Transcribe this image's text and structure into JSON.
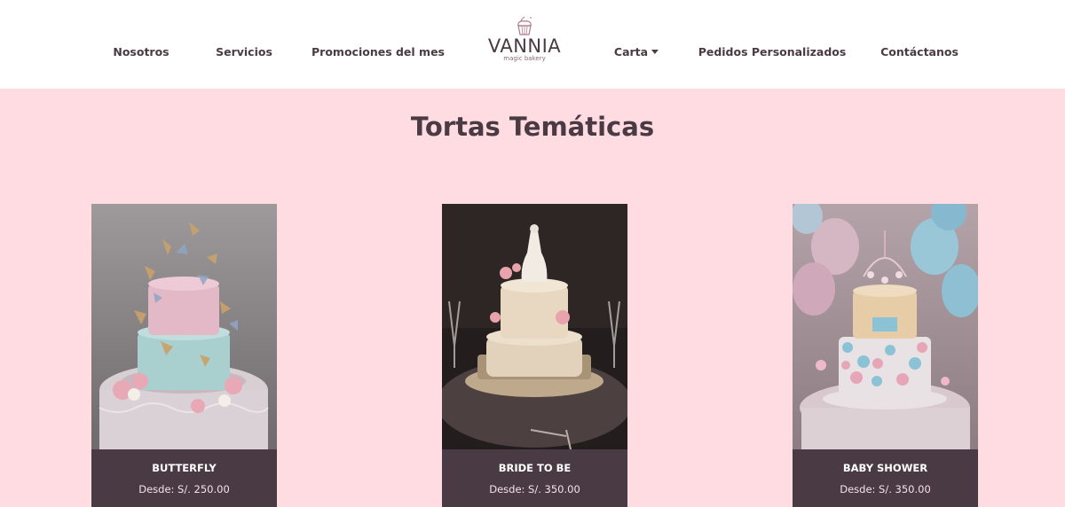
{
  "nav": {
    "left": [
      "Nosotros",
      "Servicios",
      "Promociones del mes"
    ],
    "right": [
      "Carta",
      "Pedidos Personalizados",
      "Contáctanos"
    ]
  },
  "logo": {
    "name": "VANNIA",
    "tagline": "magic bakery"
  },
  "section": {
    "title": "Tortas Temáticas"
  },
  "cards": [
    {
      "name": "BUTTERFLY",
      "price": "Desde: S/. 250.00"
    },
    {
      "name": "BRIDE TO BE",
      "price": "Desde: S/. 350.00"
    },
    {
      "name": "BABY SHOWER",
      "price": "Desde: S/. 350.00"
    }
  ],
  "colors": {
    "background": "#ffdce1",
    "header": "#ffffff",
    "text": "#4a3a43",
    "card_footer": "#4a3a43"
  },
  "icons": {
    "logo": "cupcake-icon",
    "dropdown": "caret-down-icon"
  }
}
